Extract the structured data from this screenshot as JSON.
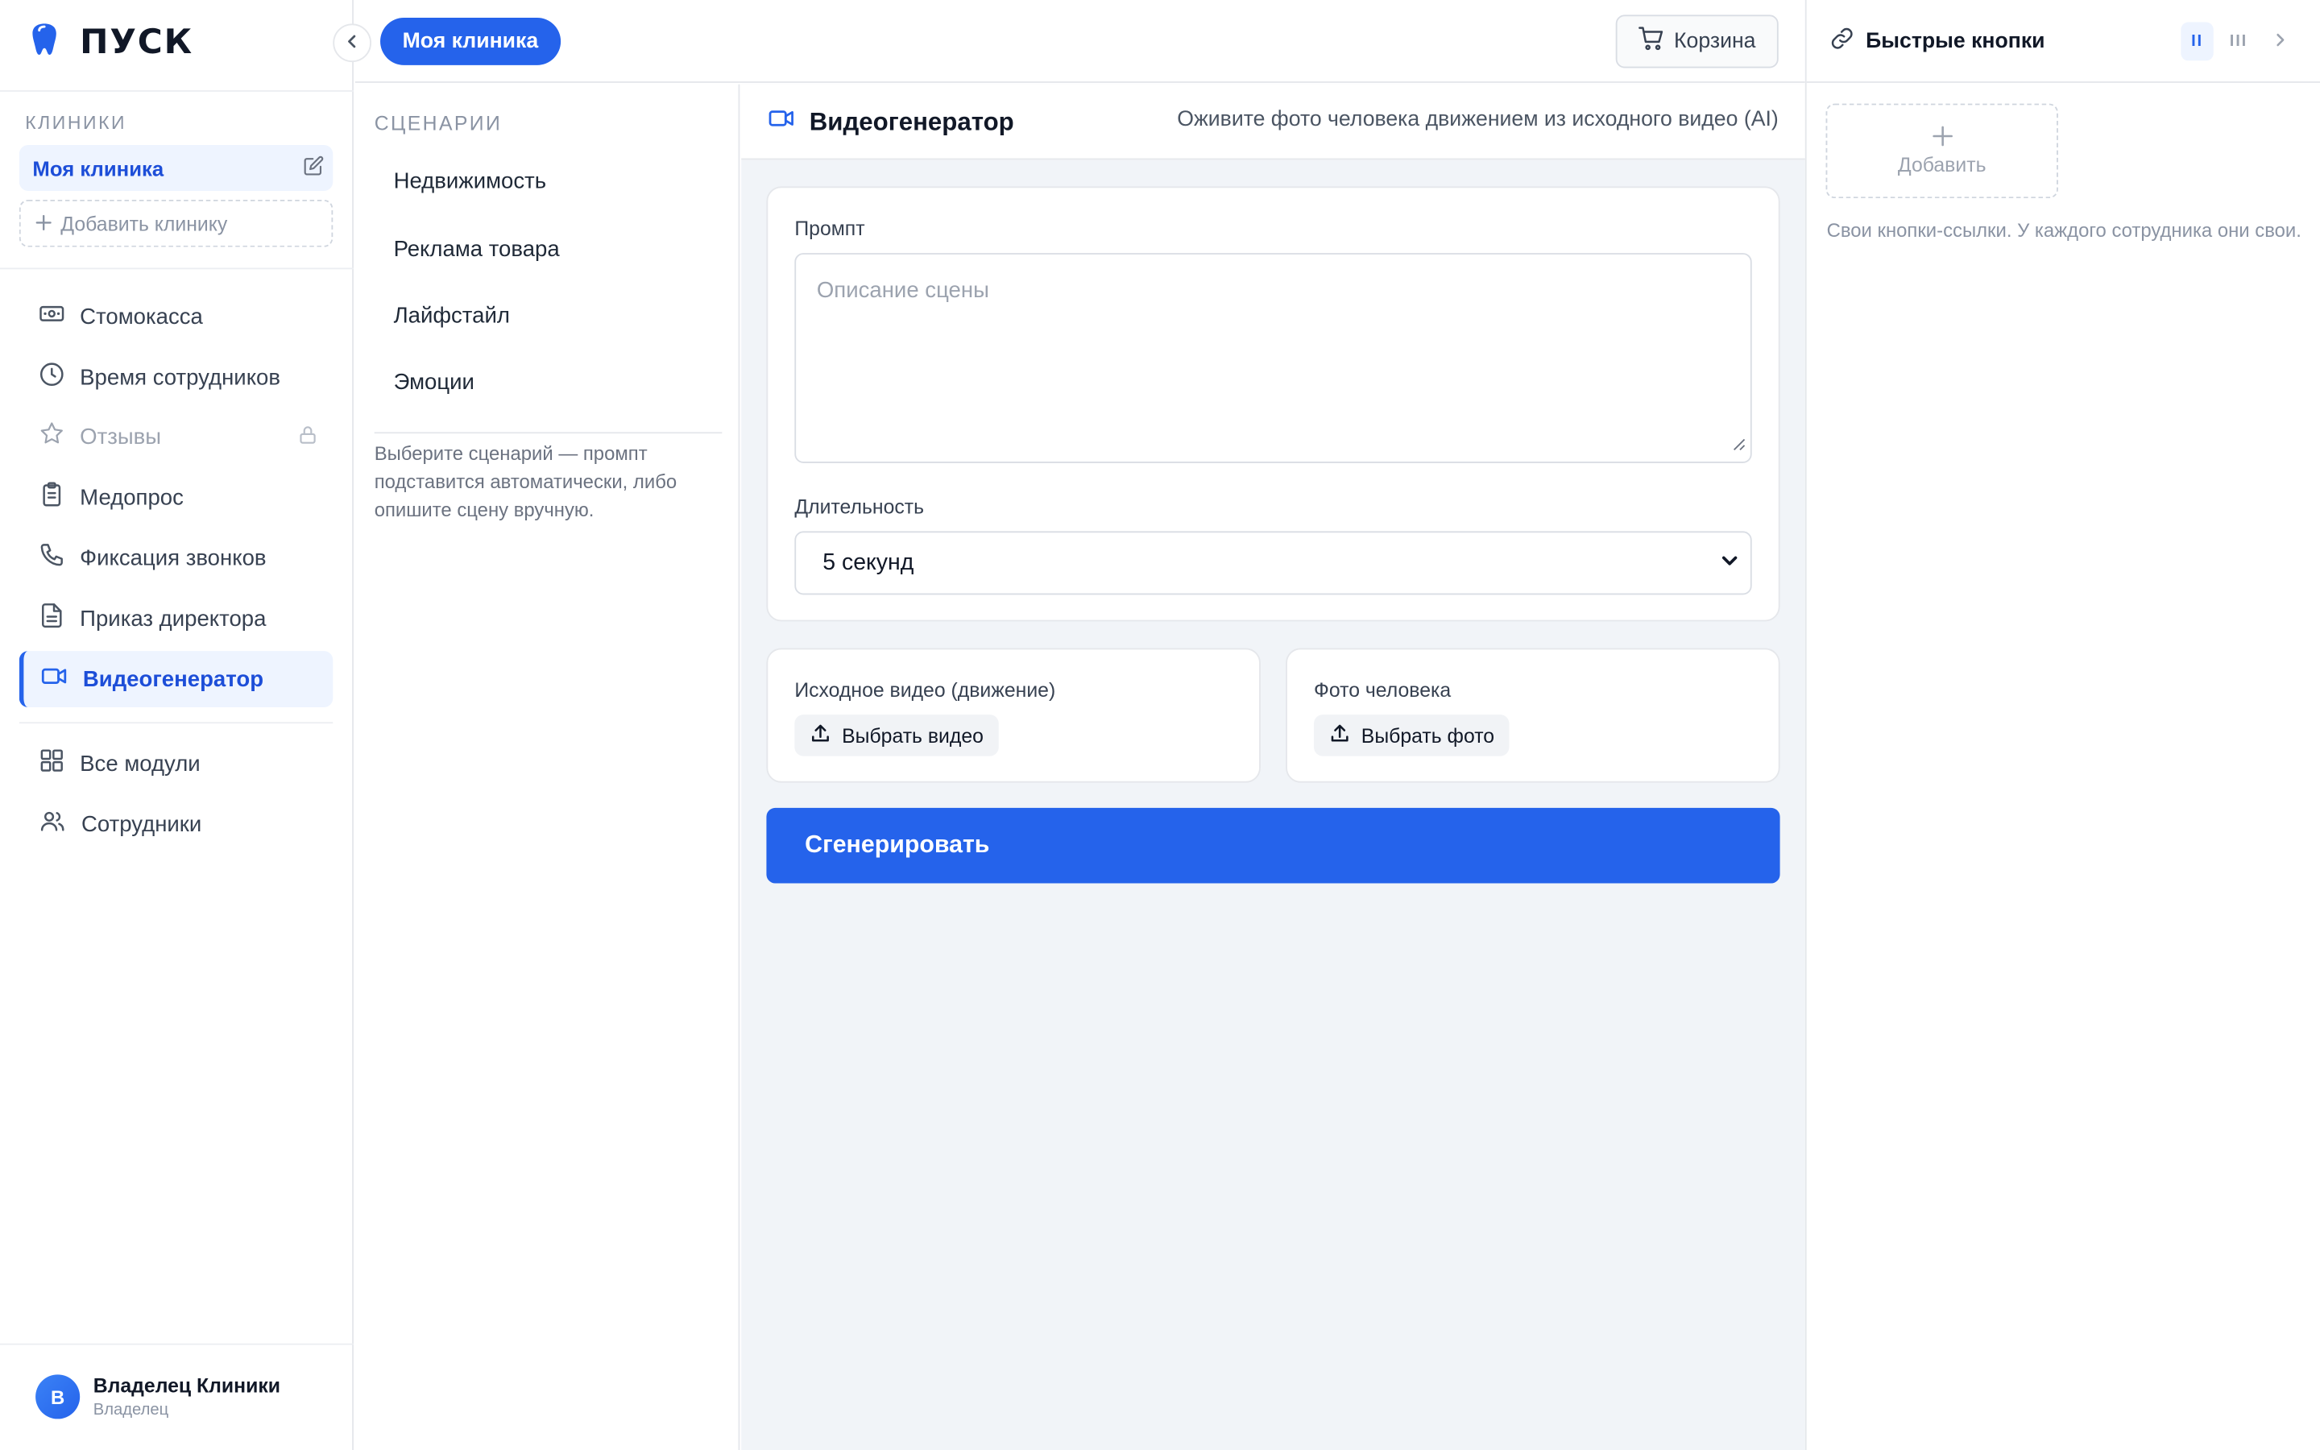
{
  "brand": {
    "name": "ПУСК"
  },
  "sidebar": {
    "clinics_label": "КЛИНИКИ",
    "active_clinic": "Моя клиника",
    "add_clinic": "Добавить клинику",
    "items": [
      {
        "label": "Стомокасса",
        "icon": "cash-icon"
      },
      {
        "label": "Время сотрудников",
        "icon": "clock-icon"
      },
      {
        "label": "Отзывы",
        "icon": "star-icon",
        "locked": true
      },
      {
        "label": "Медопрос",
        "icon": "clipboard-icon"
      },
      {
        "label": "Фиксация звонков",
        "icon": "phone-icon"
      },
      {
        "label": "Приказ директора",
        "icon": "document-icon"
      },
      {
        "label": "Видеогенератор",
        "icon": "video-icon",
        "active": true
      }
    ],
    "bottom_items": [
      {
        "label": "Все модули",
        "icon": "grid-icon"
      },
      {
        "label": "Сотрудники",
        "icon": "users-icon"
      }
    ],
    "user": {
      "initial": "В",
      "name": "Владелец Клиники",
      "role": "Владелец"
    }
  },
  "topbar": {
    "clinic_pill": "Моя клиника",
    "cart": "Корзина"
  },
  "scenarios": {
    "label": "СЦЕНАРИИ",
    "items": [
      "Недвижимость",
      "Реклама товара",
      "Лайфстайл",
      "Эмоции"
    ],
    "hint": "Выберите сценарий — промпт подставится автоматически, либо опишите сцену вручную."
  },
  "main": {
    "title": "Видеогенератор",
    "subtitle": "Оживите фото человека движением из исходного видео (AI)",
    "prompt_label": "Промпт",
    "prompt_placeholder": "Описание сцены",
    "duration_label": "Длительность",
    "duration_value": "5 секунд",
    "source_video_label": "Исходное видео (движение)",
    "source_video_button": "Выбрать видео",
    "photo_label": "Фото человека",
    "photo_button": "Выбрать фото",
    "generate": "Сгенерировать"
  },
  "quick": {
    "title": "Быстрые кнопки",
    "toggle_two": "II",
    "toggle_three": "III",
    "add": "Добавить",
    "hint": "Свои кнопки-ссылки. У каждого сотрудника они свои."
  },
  "colors": {
    "accent": "#2563eb",
    "accent_soft": "#eef4ff",
    "border": "#e5e7eb",
    "main_bg": "#f1f4f8"
  }
}
